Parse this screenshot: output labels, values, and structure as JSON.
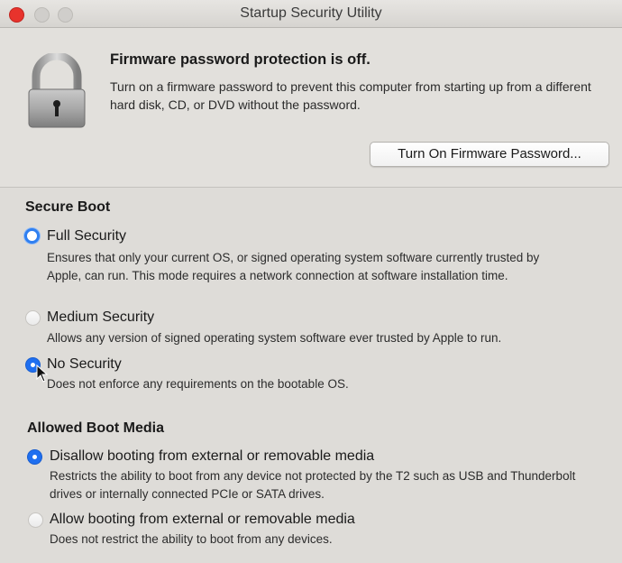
{
  "window": {
    "title": "Startup Security Utility"
  },
  "firmware": {
    "heading": "Firmware password protection is off.",
    "description": "Turn on a firmware password to prevent this computer from starting up from a different hard disk, CD, or DVD without the password.",
    "button_label": "Turn On Firmware Password..."
  },
  "secure_boot": {
    "title": "Secure Boot",
    "selected": "No Security",
    "options": [
      {
        "label": "Full Security",
        "description": "Ensures that only your current OS, or signed operating system software currently trusted by Apple, can run. This mode requires a network connection at software installation time."
      },
      {
        "label": "Medium Security",
        "description": "Allows any version of signed operating system software ever trusted by Apple to run."
      },
      {
        "label": "No Security",
        "description": "Does not enforce any requirements on the bootable OS."
      }
    ]
  },
  "boot_media": {
    "title": "Allowed Boot Media",
    "selected": "Disallow booting from external or removable media",
    "options": [
      {
        "label": "Disallow booting from external or removable media",
        "description": "Restricts the ability to boot from any device not protected by the T2 such as USB and Thunderbolt drives or internally connected PCIe or SATA drives."
      },
      {
        "label": "Allow booting from external or removable media",
        "description": "Does not restrict the ability to boot from any devices."
      }
    ]
  },
  "colors": {
    "accent": "#1f6ff0",
    "close": "#e8332c"
  },
  "icons": {
    "lock": "padlock-icon",
    "cursor": "mouse-pointer-icon"
  }
}
